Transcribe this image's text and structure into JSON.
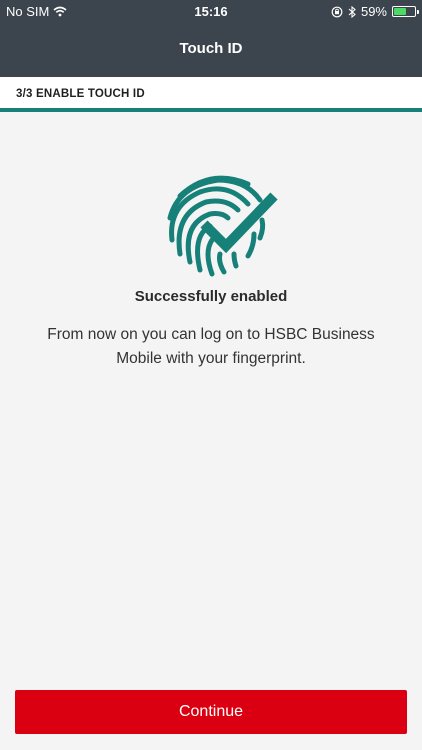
{
  "status_bar": {
    "carrier": "No SIM",
    "time": "15:16",
    "battery_percent": "59%",
    "battery_level": 0.59,
    "battery_color": "#4cd964"
  },
  "header": {
    "title": "Touch ID",
    "background": "#3c454d"
  },
  "step": {
    "label": "3/3 ENABLE TOUCH ID",
    "accent": "#168079"
  },
  "main": {
    "icon": "fingerprint-check-icon",
    "title": "Successfully enabled",
    "description": "From now on you can log on to HSBC Business Mobile with your fingerprint."
  },
  "actions": {
    "continue_label": "Continue",
    "continue_color": "#db0011"
  }
}
